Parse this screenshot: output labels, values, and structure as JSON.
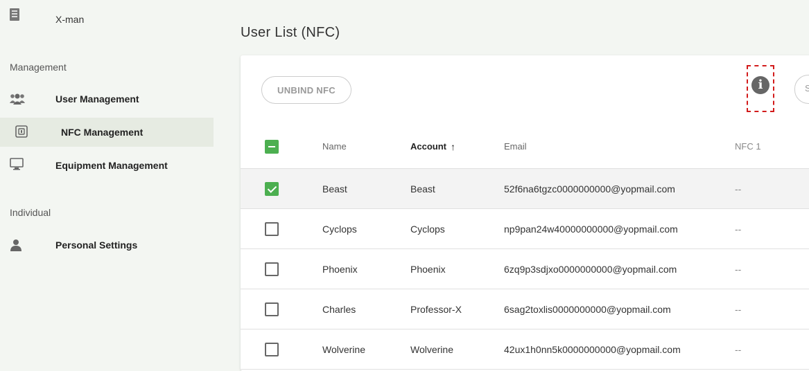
{
  "sidebar": {
    "org_name": "X-man",
    "sections": [
      {
        "label": "Management"
      },
      {
        "label": "Individual"
      }
    ],
    "items": [
      {
        "label": "User Management",
        "icon": "users-icon"
      },
      {
        "label": "NFC Management",
        "icon": "nfc-icon",
        "active": true
      },
      {
        "label": "Equipment Management",
        "icon": "monitor-icon"
      },
      {
        "label": "Personal Settings",
        "icon": "user-icon"
      }
    ]
  },
  "page": {
    "title": "User List (NFC)"
  },
  "toolbar": {
    "unbind_label": "UNBIND NFC",
    "info_icon": "i",
    "search_stub": "S"
  },
  "table": {
    "columns": [
      "Name",
      "Account",
      "Email",
      "NFC 1"
    ],
    "sort_indicator": "↑",
    "rows": [
      {
        "name": "Beast",
        "account": "Beast",
        "email": "52f6na6tgzc0000000000@yopmail.com",
        "nfc1": "--",
        "checked": true
      },
      {
        "name": "Cyclops",
        "account": "Cyclops",
        "email": "np9pan24w40000000000@yopmail.com",
        "nfc1": "--",
        "checked": false
      },
      {
        "name": "Phoenix",
        "account": "Phoenix",
        "email": "6zq9p3sdjxo0000000000@yopmail.com",
        "nfc1": "--",
        "checked": false
      },
      {
        "name": "Charles",
        "account": "Professor-X",
        "email": "6sag2toxlis0000000000@yopmail.com",
        "nfc1": "--",
        "checked": false
      },
      {
        "name": "Wolverine",
        "account": "Wolverine",
        "email": "42ux1h0nn5k0000000000@yopmail.com",
        "nfc1": "--",
        "checked": false
      }
    ]
  },
  "colors": {
    "accent": "#4caf50",
    "highlight_box": "#d21b1b",
    "active_nav": "#e6ebe2"
  }
}
